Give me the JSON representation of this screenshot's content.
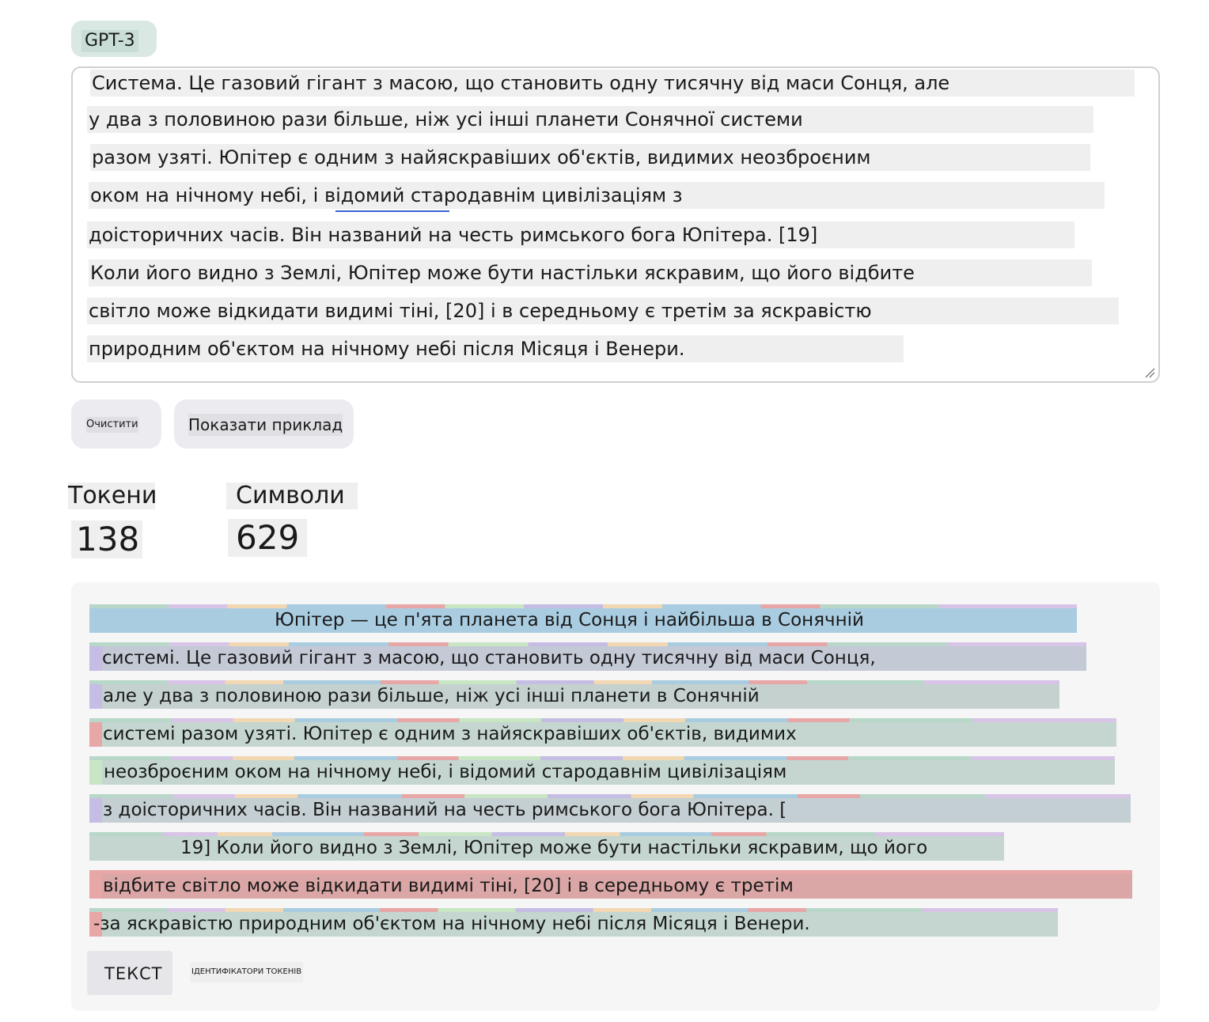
{
  "model_chip": "GPT-3",
  "input": {
    "lines": [
      "Система. Це газовий гігант з масою, що становить одну тисячну від маси Сонця, але",
      "у два з половиною рази більше, ніж усі інші планети Сонячної системи",
      "разом узяті. Юпітер є одним з найяскравіших об'єктів, видимих неозброєним",
      "оком на нічному небі, і відомий стародавнім цивілізаціям з",
      "доісторичних часів. Він названий на честь римського бога Юпітера. [19]",
      "Коли його видно з Землі, Юпітер може бути настільки яскравим, що його відбите",
      "світло може відкидати видимі тіні, [20] і в середньому є третім за яскравістю",
      "природним об'єктом на нічному небі після Місяця і Венери."
    ]
  },
  "buttons": {
    "clear": "Очистити",
    "show_example": "Показати приклад"
  },
  "stats": {
    "tokens_label": "Токени",
    "tokens_value": "138",
    "chars_label": "Символи",
    "chars_value": "629"
  },
  "output": {
    "lines": [
      "Юпітер — це п'ята планета від Сонця і найбільша в Сонячній",
      "системі. Це газовий гігант з масою, що становить одну тисячну від маси Сонця,",
      "але у два з половиною рази більше, ніж усі інші планети в Сонячній",
      "системі разом узяті. Юпітер є одним з найяскравіших об'єктів, видимих",
      "неозброєним оком на нічному небі, і відомий стародавнім цивілізаціям",
      "з доісторичних часів. Він названий на честь римського бога Юпітера. [",
      "19] Коли його видно з Землі, Юпітер може бути настільки яскравим, що його",
      "відбите світло може відкидати видимі тіні, [20] і в середньому є третім",
      "-за яскравістю природним об'єктом на нічному небі після Місяця і Венери."
    ],
    "colors": {
      "blue": "#a9cce1",
      "purple": "#c5bde4",
      "green": "#c4d6cf",
      "red": "#e8a7a7",
      "orange": "#f2d7b3",
      "lightgreen": "#c9e6c4"
    }
  },
  "view_tabs": {
    "text": "ТЕКСТ",
    "token_ids": "ІДЕНТИФІКАТОРИ ТОКЕНІВ"
  }
}
